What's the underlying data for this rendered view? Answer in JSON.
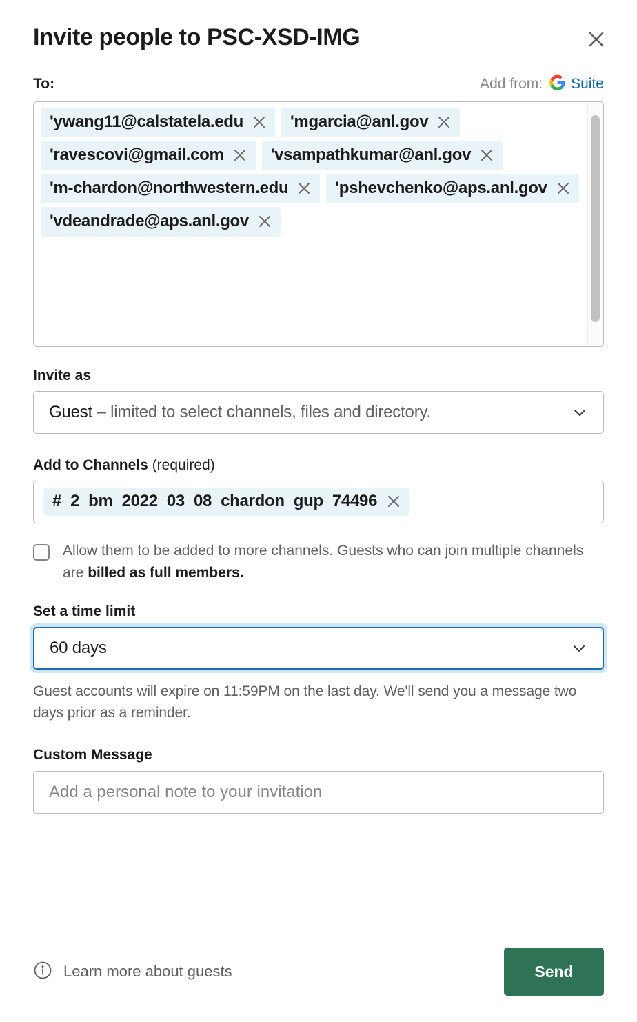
{
  "header": {
    "title": "Invite people to PSC-XSD-IMG",
    "close_icon": "close-icon"
  },
  "recipients": {
    "to_label": "To:",
    "add_from_label": "Add from:",
    "google_suite_label": "Suite",
    "google_icon": "google-g-icon",
    "chips": [
      {
        "email": "'ywang11@calstatela.edu"
      },
      {
        "email": "'mgarcia@anl.gov"
      },
      {
        "email": "'ravescovi@gmail.com"
      },
      {
        "email": "'vsampathkumar@anl.gov"
      },
      {
        "email": "'m-chardon@northwestern.edu"
      },
      {
        "email": "'pshevchenko@aps.anl.gov"
      },
      {
        "email": "'vdeandrade@aps.anl.gov"
      }
    ]
  },
  "invite_as": {
    "label": "Invite as",
    "selected_role": "Guest",
    "selected_description": "– limited to select channels, files and directory.",
    "chevron_icon": "chevron-down-icon"
  },
  "channels": {
    "label": "Add to Channels",
    "label_suffix": "(required)",
    "chip_prefix": "#",
    "chip_name": "2_bm_2022_03_08_chardon_gup_74496",
    "checkbox_checked": false,
    "checkbox_text_part1": "Allow them to be added to more channels. Guests who can join multiple channels are ",
    "checkbox_text_bold": "billed as full members."
  },
  "time_limit": {
    "label": "Set a time limit",
    "selected": "60 days",
    "chevron_icon": "chevron-down-icon",
    "helper": "Guest accounts will expire on 11:59PM on the last day. We'll send you a message two days prior as a reminder.",
    "focus_border_color": "#1d6ba8",
    "focus_ring_color": "#cfe6f7"
  },
  "custom_message": {
    "label": "Custom Message",
    "placeholder": "Add a personal note to your invitation",
    "value": ""
  },
  "footer": {
    "info_icon": "info-circle-icon",
    "learn_more_label": "Learn more about guests",
    "send_label": "Send",
    "send_color": "#2e7355"
  },
  "colors": {
    "chip_background": "#e9f4f9",
    "link_blue": "#1264a3",
    "muted_text": "#616061",
    "border": "#bbbbbb"
  }
}
